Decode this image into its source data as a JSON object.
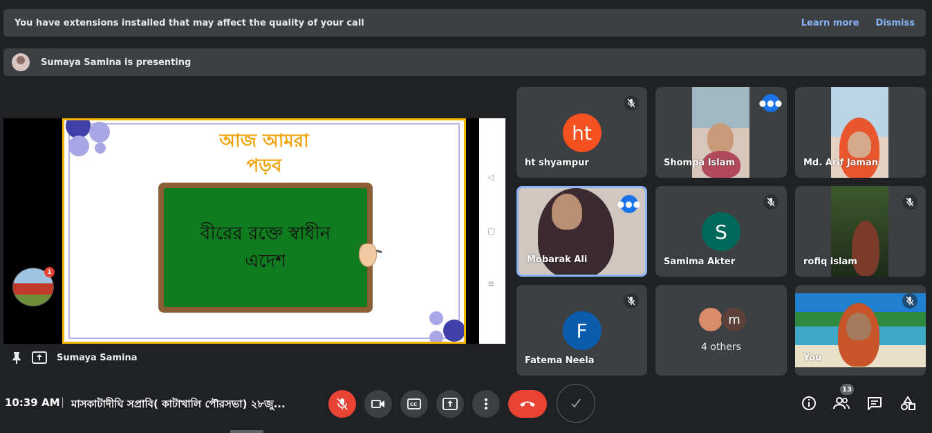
{
  "banner": {
    "message": "You have extensions installed that may affect the quality of your call",
    "learn_more": "Learn more",
    "dismiss": "Dismiss"
  },
  "presenting": {
    "message": "Sumaya Samina is presenting"
  },
  "slide": {
    "title_line1": "আজ আমরা",
    "title_line2": "পড়ব",
    "board_line1": "বীরের রক্তে স্বাধীন",
    "board_line2": "এদেশ"
  },
  "self_preview": {
    "badge": "1"
  },
  "presenter_label": {
    "name": "Sumaya Samina"
  },
  "participants": [
    {
      "name": "ht shyampur",
      "initials": "ht",
      "color": "#f4511e",
      "muted": true
    },
    {
      "name": "Shompa Islam",
      "speaking": true
    },
    {
      "name": "Md. Arif Jaman"
    },
    {
      "name": "Mobarak Ali",
      "speaking": true,
      "highlighted": true
    },
    {
      "name": "Samima Akter",
      "initials": "S",
      "color": "#00695c",
      "muted": true
    },
    {
      "name": "rofiq islam",
      "muted": true
    },
    {
      "name": "Fatema Neela",
      "initials": "F",
      "color": "#0b5cad",
      "muted": true
    },
    {
      "name": "4 others",
      "avatar_initial": "m"
    },
    {
      "name": "You",
      "muted": true
    }
  ],
  "bottom_bar": {
    "time": "10:39 AM",
    "separator": "|",
    "meeting_title": "মাসকাটাদীঘি সপ্রাবি( কাটাখালি পৌরসভা) ২৮জু...",
    "participant_count": "13"
  },
  "colors": {
    "background": "#202124",
    "surface": "#3c4043",
    "accent": "#8ab4f8",
    "danger": "#ea4335",
    "speaking": "#1a73e8"
  }
}
